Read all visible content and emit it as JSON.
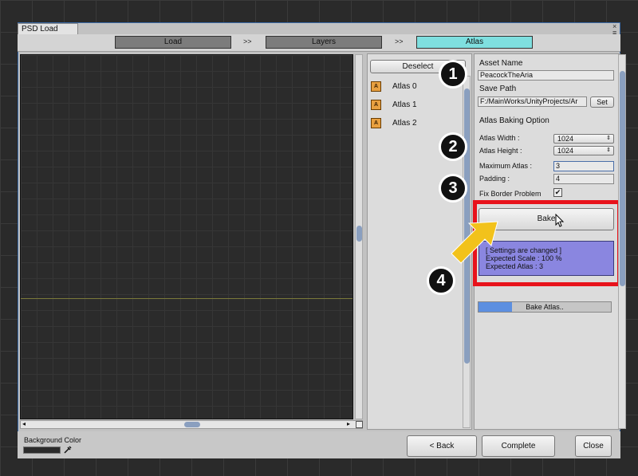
{
  "window": {
    "tab_title": "PSD Load",
    "close_glyph": "×",
    "menu_glyph": "≡"
  },
  "steps": {
    "load": "Load",
    "sep1": ">>",
    "layers": "Layers",
    "sep2": ">>",
    "atlas": "Atlas",
    "active_color": "#7fdfdf"
  },
  "list": {
    "deselect_label": "Deselect",
    "items": [
      {
        "label": "Atlas 0",
        "icon": "atlas-icon"
      },
      {
        "label": "Atlas 1",
        "icon": "atlas-icon"
      },
      {
        "label": "Atlas 2",
        "icon": "atlas-icon"
      }
    ],
    "icon_glyph": "A"
  },
  "settings": {
    "asset_name_label": "Asset Name",
    "asset_name_value": "PeacockTheAria",
    "save_path_label": "Save Path",
    "save_path_value": "F:/MainWorks/UnityProjects/Ar",
    "set_label": "Set",
    "baking_option_label": "Atlas Baking Option",
    "atlas_width_label": "Atlas Width :",
    "atlas_width_value": "1024",
    "atlas_height_label": "Atlas Height :",
    "atlas_height_value": "1024",
    "max_atlas_label": "Maximum Atlas :",
    "max_atlas_value": "3",
    "padding_label": "Padding :",
    "padding_value": "4",
    "fix_border_label": "Fix Border Problem",
    "fix_border_checked": true,
    "check_glyph": "✔",
    "bake_label": "Bake",
    "info_line1": "[ Settings are changed ]",
    "info_line2": "Expected Scale : 100 %",
    "info_line3": "Expected Atlas : 3",
    "info_color": "#8a86e0",
    "progress_label": "Bake Atlas..",
    "progress_fraction": 0.25,
    "progress_color": "#5c8fe0"
  },
  "annotations": {
    "step1": "1",
    "step2": "2",
    "step3": "3",
    "step4": "4",
    "highlight_color": "#e8121b",
    "arrow_color": "#f2c21b"
  },
  "footer": {
    "background_color_label": "Background Color",
    "back_label": "< Back",
    "complete_label": "Complete",
    "close_label": "Close"
  }
}
